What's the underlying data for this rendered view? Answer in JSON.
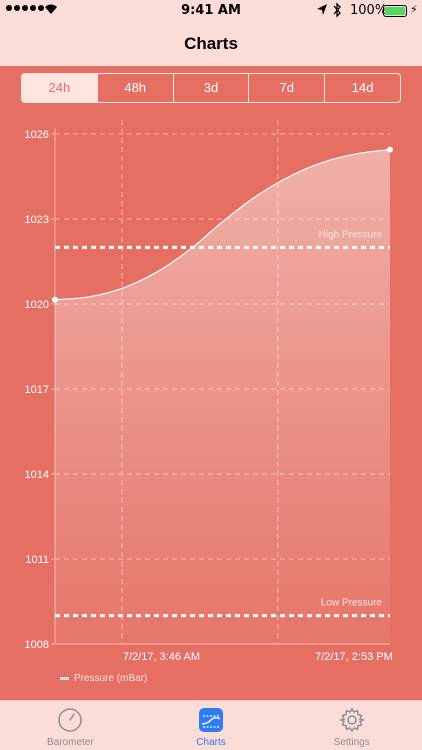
{
  "status_bar": {
    "time": "9:41 AM",
    "battery_percent": "100%"
  },
  "nav": {
    "title": "Charts"
  },
  "range_tabs": [
    {
      "label": "24h",
      "selected": true
    },
    {
      "label": "48h",
      "selected": false
    },
    {
      "label": "3d",
      "selected": false
    },
    {
      "label": "7d",
      "selected": false
    },
    {
      "label": "14d",
      "selected": false
    }
  ],
  "chart_data": {
    "type": "area",
    "ylim": [
      1008,
      1026
    ],
    "y_ticks": [
      1026,
      1023,
      1020,
      1017,
      1014,
      1011,
      1008
    ],
    "x_tick_labels": [
      "7/2/17, 3:46 AM",
      "7/2/17, 2:53 PM"
    ],
    "series": [
      {
        "name": "Pressure (mBar)",
        "x": [
          0,
          0.1,
          0.2,
          0.3,
          0.4,
          0.5,
          0.6,
          0.7,
          0.8,
          0.9,
          1.0
        ],
        "values": [
          1020.15,
          1020.25,
          1020.55,
          1021.1,
          1021.9,
          1022.9,
          1023.8,
          1024.5,
          1025.0,
          1025.3,
          1025.45
        ]
      }
    ],
    "limits": [
      {
        "label": "High Pressure",
        "value": 1022
      },
      {
        "label": "Low Pressure",
        "value": 1009
      }
    ],
    "grid": true,
    "legend": "bottom-left"
  },
  "tabs": [
    {
      "label": "Barometer",
      "icon": "gauge-icon",
      "selected": false
    },
    {
      "label": "Charts",
      "icon": "chart-icon",
      "selected": true
    },
    {
      "label": "Settings",
      "icon": "gear-icon",
      "selected": false
    }
  ],
  "colors": {
    "background": "#e46f62",
    "bars": "#fcdcd6",
    "accent": "#2f7cf6"
  }
}
